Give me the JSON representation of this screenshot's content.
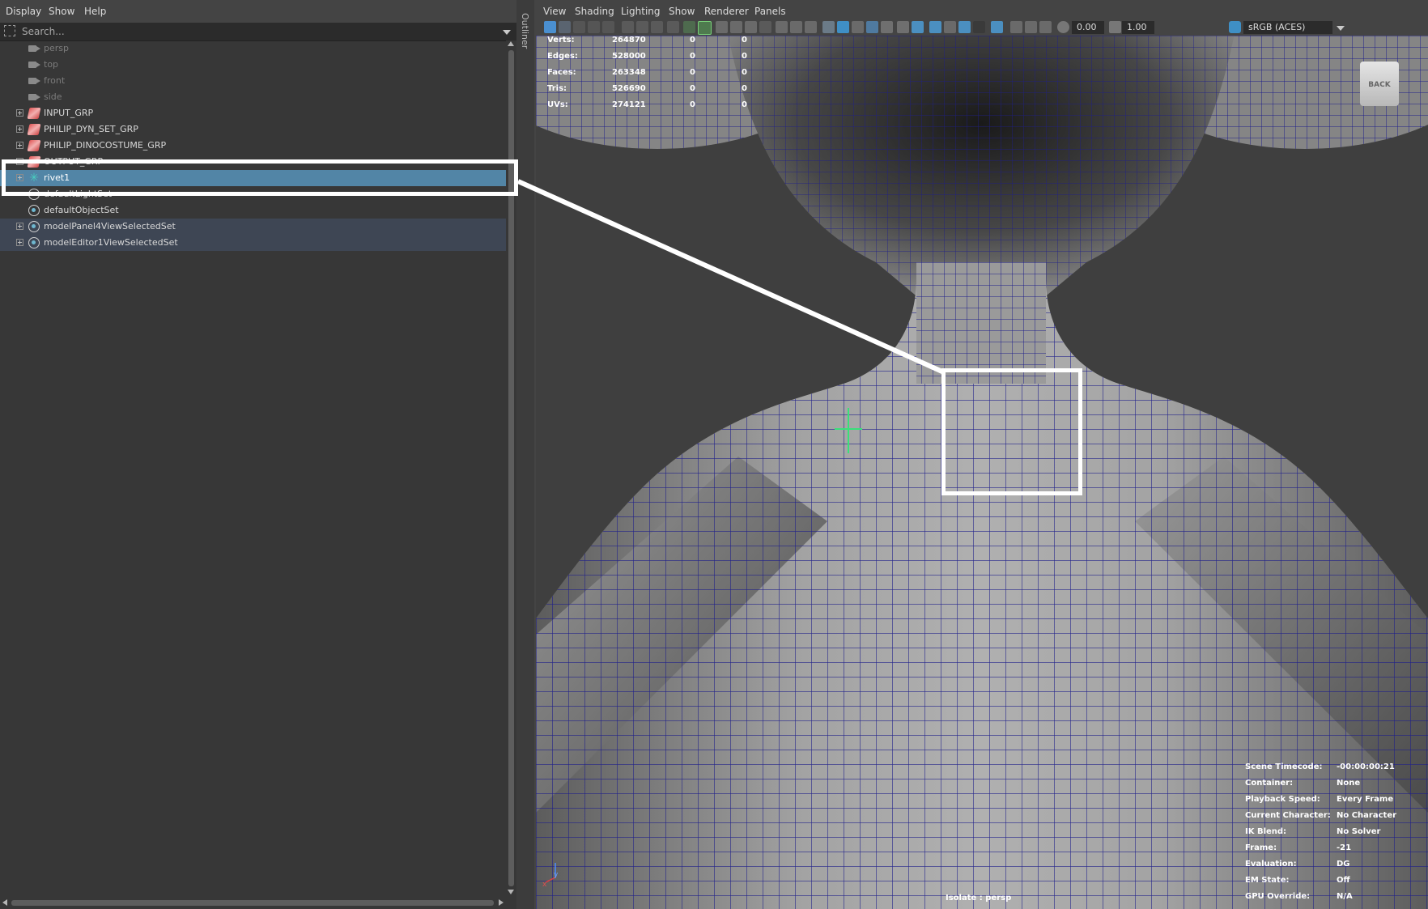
{
  "outliner": {
    "menu": [
      "Display",
      "Show",
      "Help"
    ],
    "search_placeholder": "Search...",
    "side_tab": "Outliner",
    "items": [
      {
        "label": "persp",
        "icon": "camera-icon"
      },
      {
        "label": "top",
        "icon": "camera-icon"
      },
      {
        "label": "front",
        "icon": "camera-icon"
      },
      {
        "label": "side",
        "icon": "camera-icon"
      },
      {
        "label": "INPUT_GRP",
        "icon": "group-icon"
      },
      {
        "label": "PHILIP_DYN_SET_GRP",
        "icon": "group-icon"
      },
      {
        "label": "PHILIP_DINOCOSTUME_GRP",
        "icon": "group-icon"
      },
      {
        "label": "OUTPUT_GRP",
        "icon": "group-icon"
      },
      {
        "label": "rivet1",
        "icon": "rivet-icon"
      },
      {
        "label": "defaultLightSet",
        "icon": "set-icon"
      },
      {
        "label": "defaultObjectSet",
        "icon": "set-icon"
      },
      {
        "label": "modelPanel4ViewSelectedSet",
        "icon": "set-icon"
      },
      {
        "label": "modelEditor1ViewSelectedSet",
        "icon": "set-icon"
      }
    ]
  },
  "viewport": {
    "menu": [
      "View",
      "Shading",
      "Lighting",
      "Show",
      "Renderer",
      "Panels"
    ],
    "exposure": "0.00",
    "gamma": "1.00",
    "color_space": "sRGB (ACES)",
    "stats": [
      {
        "label": "Verts:",
        "value": "264870",
        "a": "0",
        "b": "0"
      },
      {
        "label": "Edges:",
        "value": "528000",
        "a": "0",
        "b": "0"
      },
      {
        "label": "Faces:",
        "value": "263348",
        "a": "0",
        "b": "0"
      },
      {
        "label": "Tris:",
        "value": "526690",
        "a": "0",
        "b": "0"
      },
      {
        "label": "UVs:",
        "value": "274121",
        "a": "0",
        "b": "0"
      }
    ],
    "info": [
      {
        "label": "Scene Timecode:",
        "value": "-00:00:00:21"
      },
      {
        "label": "Container:",
        "value": "None"
      },
      {
        "label": "Playback Speed:",
        "value": "Every Frame"
      },
      {
        "label": "Current Character:",
        "value": "No Character"
      },
      {
        "label": "IK Blend:",
        "value": "No Solver"
      },
      {
        "label": "Frame:",
        "value": "-21"
      },
      {
        "label": "Evaluation:",
        "value": "DG"
      },
      {
        "label": "EM State:",
        "value": "Off"
      },
      {
        "label": "GPU Override:",
        "value": "N/A"
      }
    ],
    "view_cube_label": "BACK",
    "isolate_label": "Isolate : persp",
    "axis_y": "y",
    "axis_x": "x"
  },
  "colors": {
    "selection": "#5285a6",
    "highlight": "#3e4654",
    "wireframe": "#1e1e8a",
    "rivet_locator": "#39e07a",
    "annotation": "#ffffff"
  }
}
